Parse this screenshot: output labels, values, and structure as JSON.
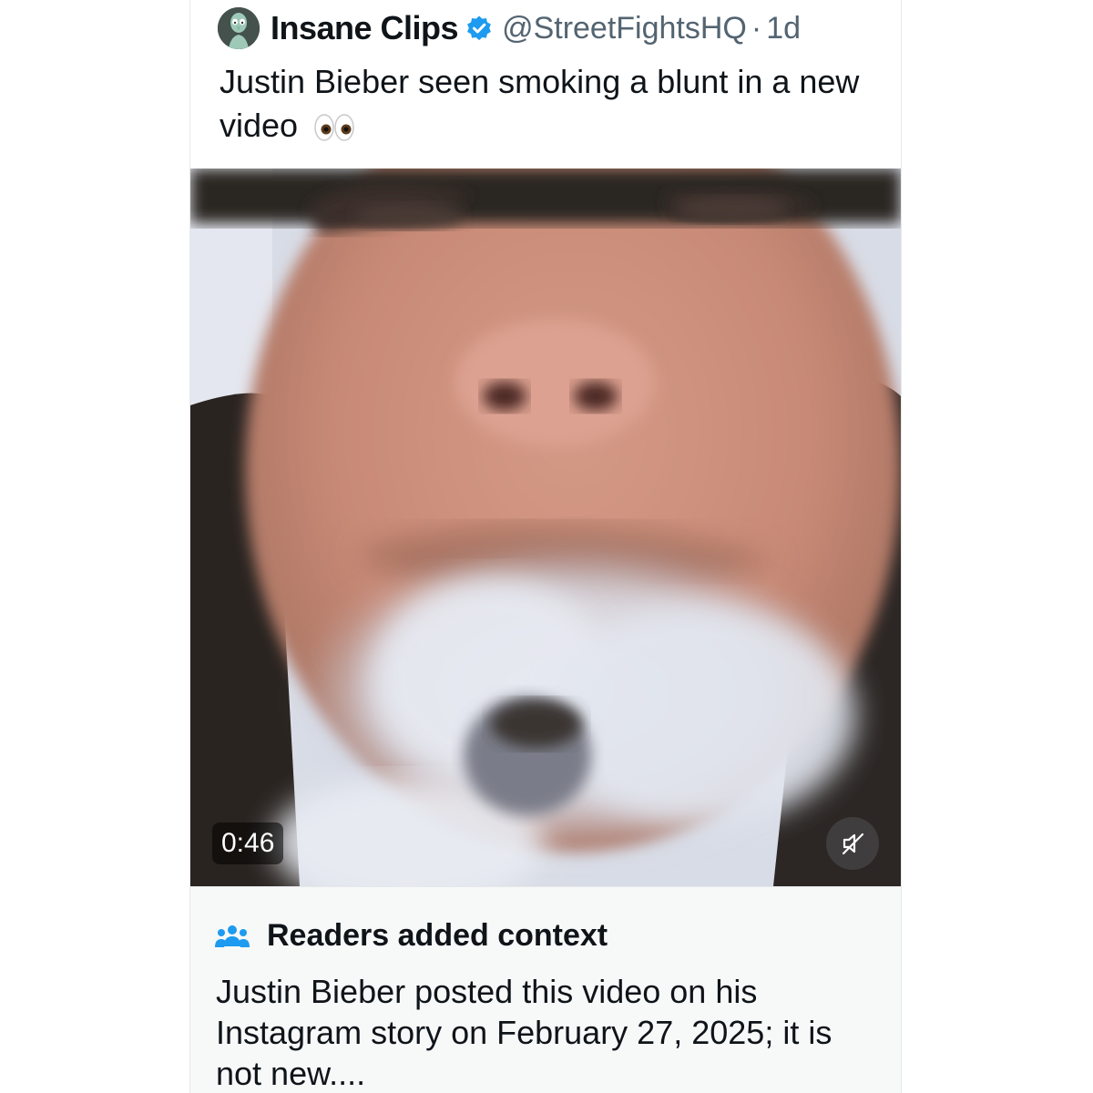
{
  "post": {
    "display_name": "Insane Clips",
    "handle": "@StreetFightsHQ",
    "separator": "·",
    "timestamp": "1d",
    "avatar_icon": "squidward-avatar-icon",
    "verified_icon": "verified-badge-icon",
    "verified_color": "#1d9bf0",
    "text": "Justin Bieber seen smoking a blunt in a new video",
    "emoji_icon": "eyes-emoji-icon"
  },
  "video": {
    "duration": "0:46",
    "mute_icon": "muted-speaker-icon"
  },
  "community_note": {
    "icon": "people-icon",
    "title": "Readers added context",
    "body": "Justin Bieber posted this video on his Instagram story on February 27, 2025; it is not new...."
  },
  "colors": {
    "text_primary": "#0f1419",
    "text_secondary": "#536471",
    "accent": "#1d9bf0",
    "note_background": "#f7f9f9"
  }
}
